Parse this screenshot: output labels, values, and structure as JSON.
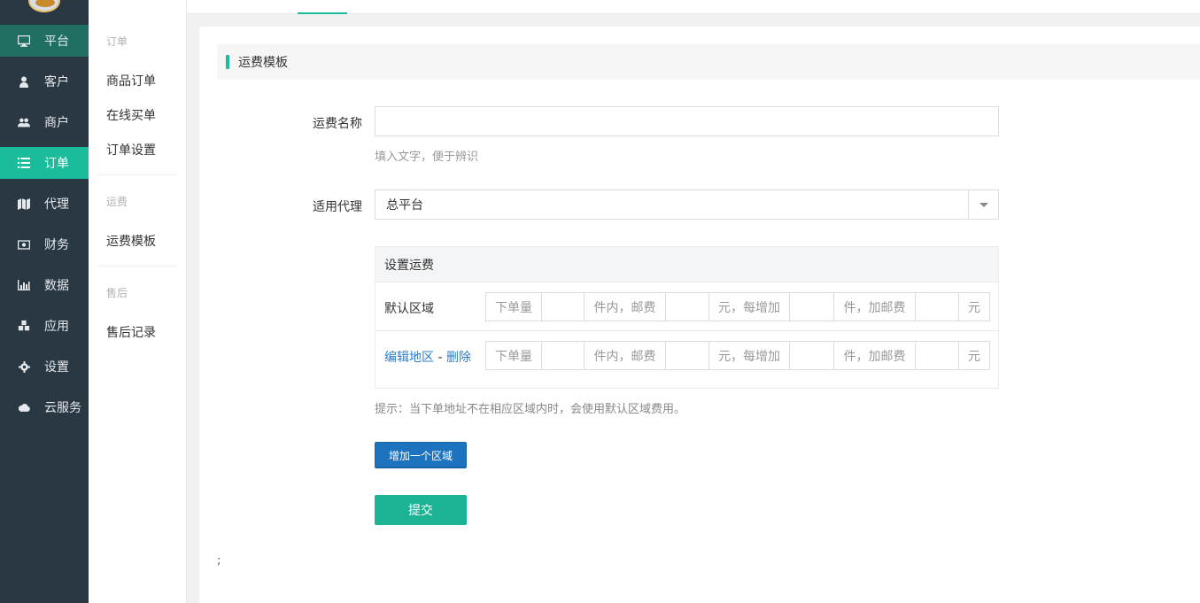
{
  "sidebar": {
    "items": [
      {
        "label": "平台",
        "icon": "monitor-icon"
      },
      {
        "label": "客户",
        "icon": "user-icon"
      },
      {
        "label": "商户",
        "icon": "users-icon"
      },
      {
        "label": "订单",
        "icon": "list-icon"
      },
      {
        "label": "代理",
        "icon": "map-icon"
      },
      {
        "label": "财务",
        "icon": "money-icon"
      },
      {
        "label": "数据",
        "icon": "bar-chart-icon"
      },
      {
        "label": "应用",
        "icon": "cubes-icon"
      },
      {
        "label": "设置",
        "icon": "gear-icon"
      },
      {
        "label": "云服务",
        "icon": "cloud-icon"
      }
    ],
    "active_index": 3
  },
  "subnav": {
    "groups": [
      {
        "title": "订单",
        "items": [
          "商品订单",
          "在线买单",
          "订单设置"
        ]
      },
      {
        "title": "运费",
        "items": [
          "运费模板"
        ]
      },
      {
        "title": "售后",
        "items": [
          "售后记录"
        ]
      }
    ]
  },
  "section": {
    "title": "运费模板"
  },
  "form": {
    "name_label": "运费名称",
    "name_value": "",
    "name_help": "填入文字，便于辨识",
    "agent_label": "适用代理",
    "agent_value": "总平台"
  },
  "fee": {
    "header": "设置运费",
    "default_region_label": "默认区域",
    "edit_region_link": "编辑地区",
    "separator": "-",
    "delete_link": "删除",
    "segments": [
      "下单量",
      "件内，邮费",
      "元，每增加",
      "件，加邮费",
      "元"
    ]
  },
  "tip": "提示：当下单地址不在相应区域内时，会使用默认区域费用。",
  "buttons": {
    "add_region": "增加一个区域",
    "submit": "提交"
  },
  "footer_text": ";"
}
